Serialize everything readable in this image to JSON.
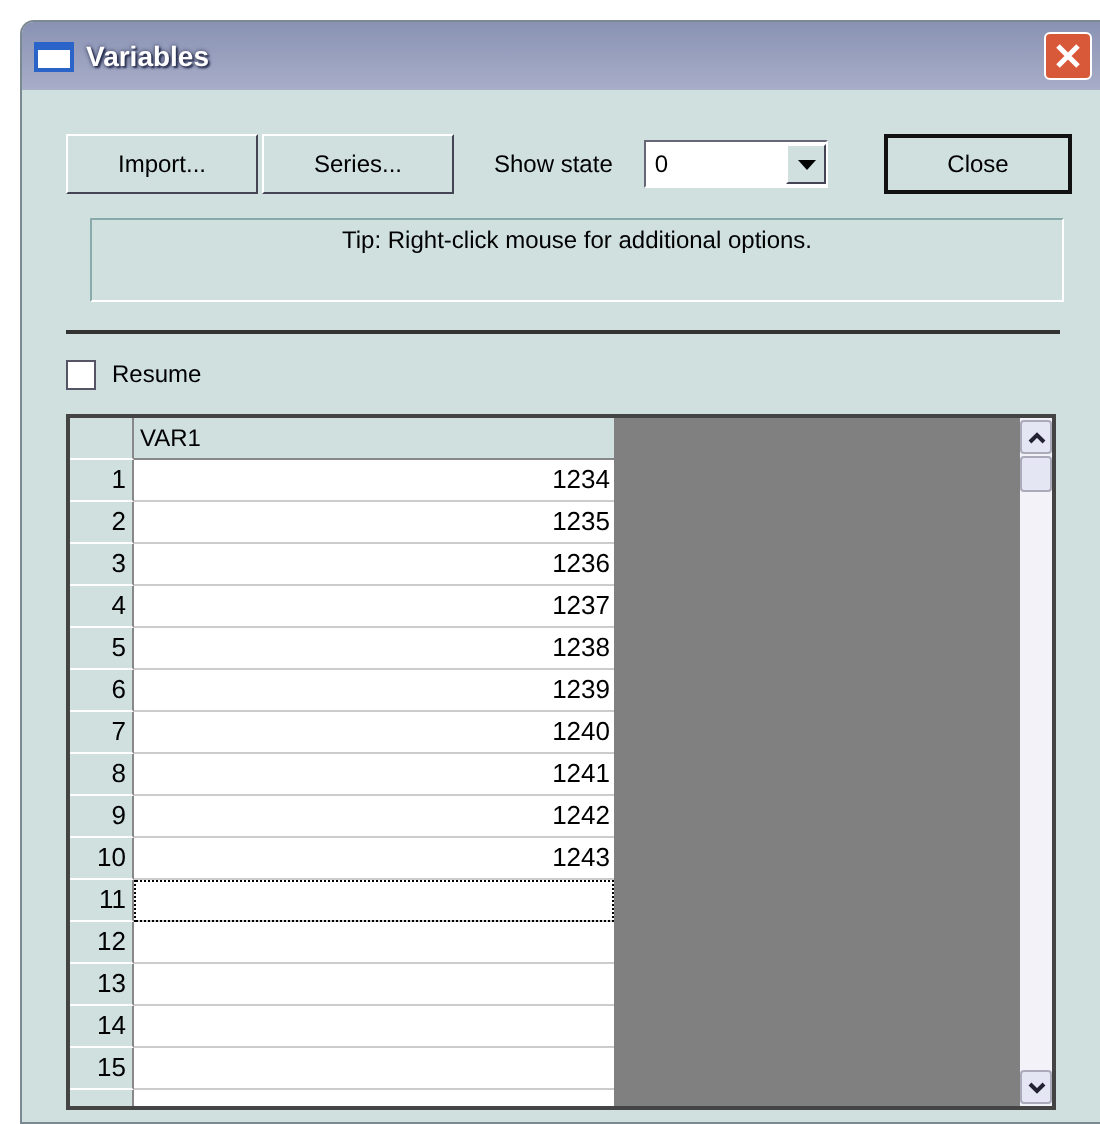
{
  "window": {
    "title": "Variables"
  },
  "toolbar": {
    "buttons": [
      {
        "label": "Import..."
      },
      {
        "label": "Series..."
      }
    ],
    "show_state_label": "Show state",
    "show_state_value": "0",
    "close_button": {
      "label": "Close",
      "default": true
    }
  },
  "tip": "Tip:  Right-click mouse for additional options.",
  "resume": {
    "label": "Resume",
    "checked": false
  },
  "grid": {
    "columns": [
      "VAR1"
    ],
    "rows": [
      {
        "number": "1",
        "value": "1234",
        "focused": false
      },
      {
        "number": "2",
        "value": "1235",
        "focused": false
      },
      {
        "number": "3",
        "value": "1236",
        "focused": false
      },
      {
        "number": "4",
        "value": "1237",
        "focused": false
      },
      {
        "number": "5",
        "value": "1238",
        "focused": false
      },
      {
        "number": "6",
        "value": "1239",
        "focused": false
      },
      {
        "number": "7",
        "value": "1240",
        "focused": false
      },
      {
        "number": "8",
        "value": "1241",
        "focused": false
      },
      {
        "number": "9",
        "value": "1242",
        "focused": false
      },
      {
        "number": "10",
        "value": "1243",
        "focused": false
      },
      {
        "number": "11",
        "focused": true
      },
      {
        "number": "12",
        "focused": false
      },
      {
        "number": "13",
        "focused": false
      },
      {
        "number": "14",
        "focused": false
      },
      {
        "number": "15",
        "focused": false
      }
    ]
  }
}
